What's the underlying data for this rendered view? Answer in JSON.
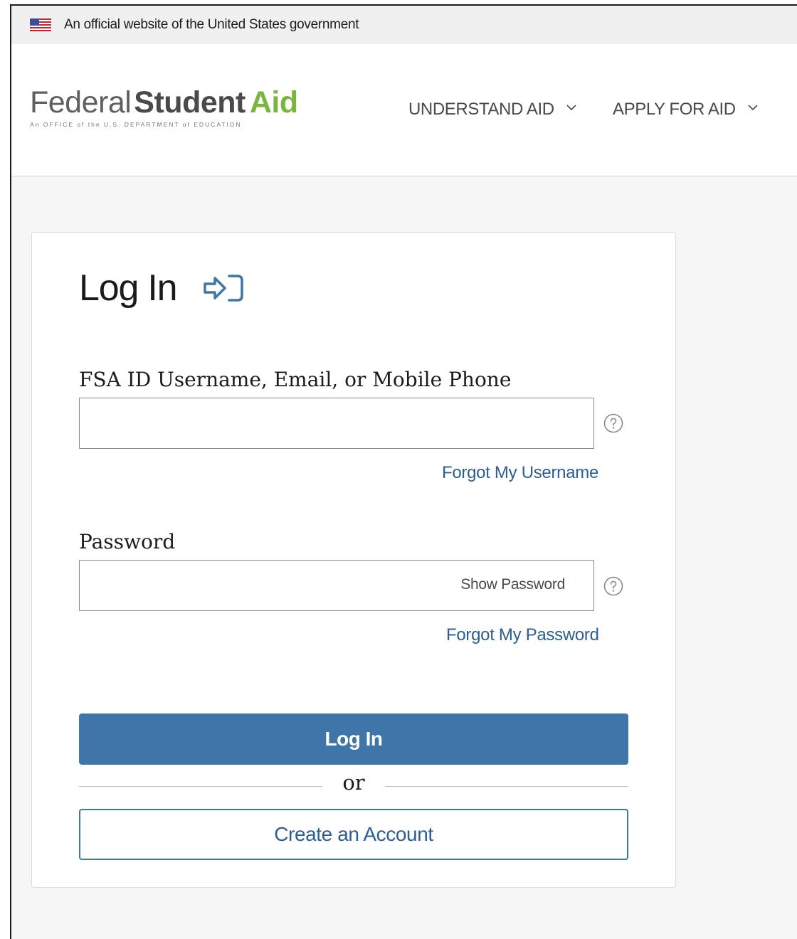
{
  "gov_banner": {
    "text": "An official website of the United States government",
    "flag_icon": "us-flag-icon"
  },
  "header": {
    "logo": {
      "federal": "Federal",
      "student": "Student",
      "aid": "Aid",
      "subtitle": "An OFFICE of the U.S. DEPARTMENT of EDUCATION"
    },
    "nav": [
      {
        "label": "UNDERSTAND AID",
        "icon": "chevron-down-icon"
      },
      {
        "label": "APPLY FOR AID",
        "icon": "chevron-down-icon"
      }
    ]
  },
  "login": {
    "title": "Log In",
    "title_icon": "login-arrow-icon",
    "username_label": "FSA ID Username, Email, or Mobile Phone",
    "username_value": "",
    "forgot_username": "Forgot My Username",
    "password_label": "Password",
    "password_value": "",
    "show_password": "Show Password",
    "forgot_password": "Forgot My Password",
    "submit": "Log In",
    "or": "or",
    "create_account": "Create an Account"
  },
  "colors": {
    "brand_green": "#79b640",
    "primary_blue": "#3e76a9",
    "link_blue": "#2b5e93"
  }
}
